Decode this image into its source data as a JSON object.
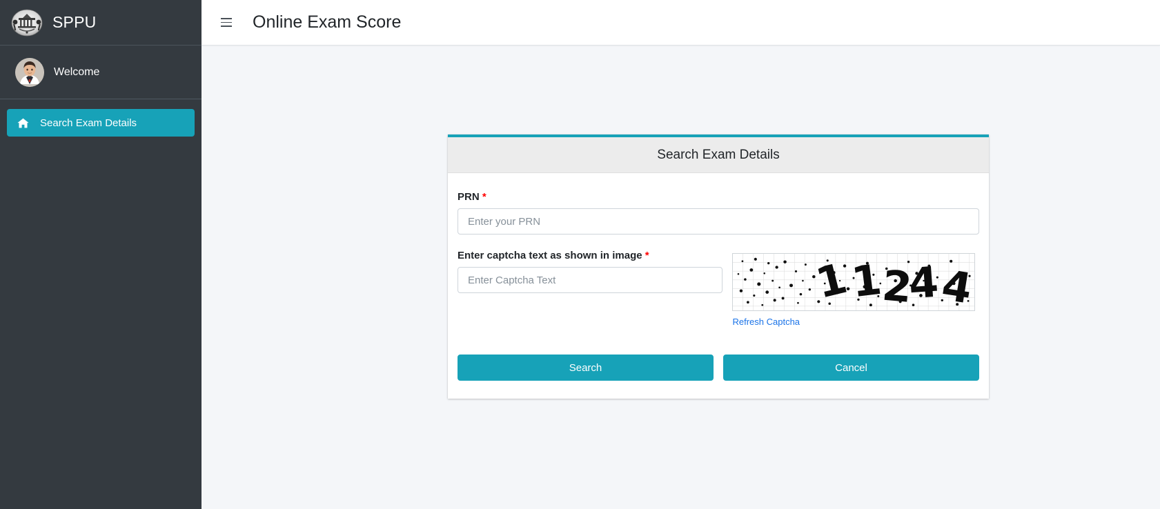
{
  "sidebar": {
    "brand": {
      "logo_icon": "university-crest-icon",
      "title": "SPPU"
    },
    "user": {
      "avatar_icon": "user-avatar",
      "name": "Welcome"
    },
    "items": [
      {
        "icon": "home-icon",
        "label": "Search Exam Details",
        "active": true
      }
    ]
  },
  "topbar": {
    "menu_icon": "hamburger-menu-icon",
    "title": "Online Exam Score"
  },
  "card": {
    "title": "Search Exam Details",
    "accent_color": "#17a2b8",
    "header_bg": "#ececec",
    "fields": {
      "prn": {
        "label": "PRN",
        "required_mark": "*",
        "placeholder": "Enter your PRN",
        "value": ""
      },
      "captcha": {
        "label": "Enter captcha text as shown in image",
        "required_mark": "*",
        "placeholder": "Enter Captcha Text",
        "value": "",
        "image_text": "11244",
        "image_alt": "captcha-image",
        "refresh_label": "Refresh Captcha",
        "refresh_color": "#1a73e8"
      }
    },
    "buttons": {
      "search_label": "Search",
      "cancel_label": "Cancel",
      "color": "#17a2b8"
    }
  }
}
